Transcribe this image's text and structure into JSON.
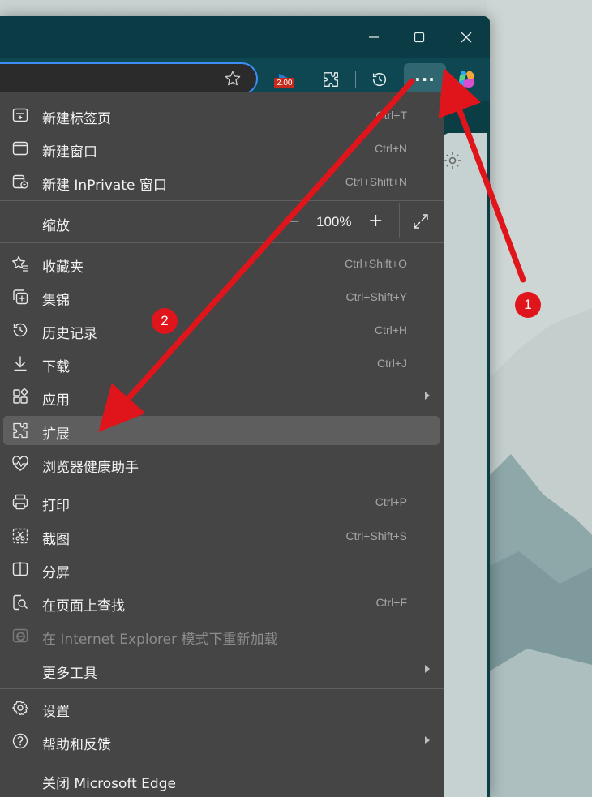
{
  "window": {
    "controls": {
      "minimize_icon": "minimize-icon",
      "maximize_icon": "maximize-icon",
      "close_icon": "close-icon"
    }
  },
  "toolbar": {
    "extension_badge": "2.00",
    "more_icon": "···"
  },
  "menu": {
    "items": [
      {
        "label": "新建标签页",
        "shortcut": "Ctrl+T"
      },
      {
        "label": "新建窗口",
        "shortcut": "Ctrl+N"
      },
      {
        "label": "新建 InPrivate 窗口",
        "shortcut": "Ctrl+Shift+N"
      },
      {
        "label": "缩放",
        "zoom_out": "−",
        "zoom_value": "100%",
        "zoom_in": "+"
      },
      {
        "label": "收藏夹",
        "shortcut": "Ctrl+Shift+O"
      },
      {
        "label": "集锦",
        "shortcut": "Ctrl+Shift+Y"
      },
      {
        "label": "历史记录",
        "shortcut": "Ctrl+H"
      },
      {
        "label": "下载",
        "shortcut": "Ctrl+J"
      },
      {
        "label": "应用"
      },
      {
        "label": "扩展"
      },
      {
        "label": "浏览器健康助手"
      },
      {
        "label": "打印",
        "shortcut": "Ctrl+P"
      },
      {
        "label": "截图",
        "shortcut": "Ctrl+Shift+S"
      },
      {
        "label": "分屏"
      },
      {
        "label": "在页面上查找",
        "shortcut": "Ctrl+F"
      },
      {
        "label": "在 Internet Explorer 模式下重新加载"
      },
      {
        "label": "更多工具"
      },
      {
        "label": "设置"
      },
      {
        "label": "帮助和反馈"
      },
      {
        "label": "关闭 Microsoft Edge"
      }
    ],
    "highlighted": "扩展"
  },
  "annotations": {
    "step1": "1",
    "step2": "2",
    "color": "#e0151b"
  }
}
